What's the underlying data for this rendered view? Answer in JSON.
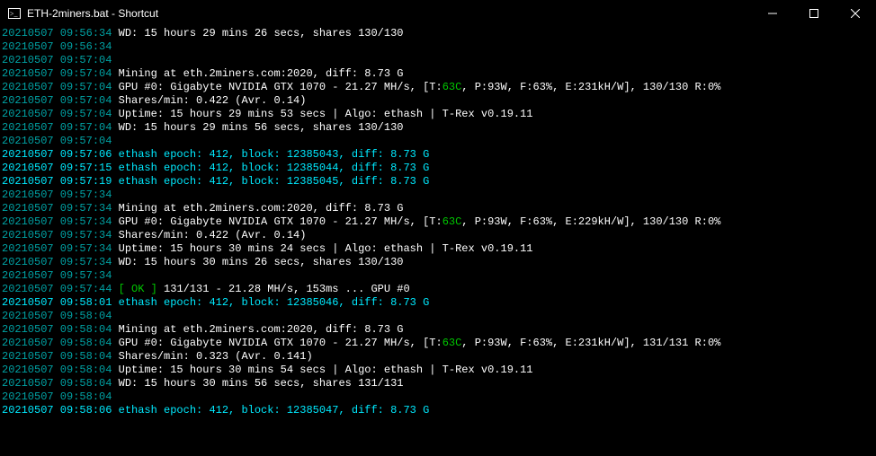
{
  "window": {
    "title": "ETH-2miners.bat - Shortcut"
  },
  "lines": [
    {
      "segs": [
        {
          "c": "ts",
          "t": "20210507 09:56:34"
        },
        {
          "c": "white",
          "t": " WD: 15 hours 29 mins 26 secs, shares 130/130"
        }
      ]
    },
    {
      "segs": [
        {
          "c": "ts",
          "t": "20210507 09:56:34"
        }
      ]
    },
    {
      "segs": [
        {
          "c": "ts",
          "t": "20210507 09:57:04"
        }
      ]
    },
    {
      "segs": [
        {
          "c": "ts",
          "t": "20210507 09:57:04"
        },
        {
          "c": "white",
          "t": " Mining at eth.2miners.com:2020, diff: 8.73 G"
        }
      ]
    },
    {
      "segs": [
        {
          "c": "ts",
          "t": "20210507 09:57:04"
        },
        {
          "c": "white",
          "t": " GPU #0: Gigabyte NVIDIA GTX 1070 - 21.27 MH/s, [T:"
        },
        {
          "c": "green",
          "t": "63C"
        },
        {
          "c": "white",
          "t": ", P:93W, F:63%, E:231kH/W], 130/130 R:0%"
        }
      ]
    },
    {
      "segs": [
        {
          "c": "ts",
          "t": "20210507 09:57:04"
        },
        {
          "c": "white",
          "t": " Shares/min: 0.422 (Avr. 0.14)"
        }
      ]
    },
    {
      "segs": [
        {
          "c": "ts",
          "t": "20210507 09:57:04"
        },
        {
          "c": "white",
          "t": " Uptime: 15 hours 29 mins 53 secs | Algo: ethash | T-Rex v0.19.11"
        }
      ]
    },
    {
      "segs": [
        {
          "c": "ts",
          "t": "20210507 09:57:04"
        },
        {
          "c": "white",
          "t": " WD: 15 hours 29 mins 56 secs, shares 130/130"
        }
      ]
    },
    {
      "segs": [
        {
          "c": "ts",
          "t": "20210507 09:57:04"
        }
      ]
    },
    {
      "segs": [
        {
          "c": "cyan",
          "t": "20210507 09:57:06 ethash epoch: 412, block: 12385043, diff: 8.73 G"
        }
      ]
    },
    {
      "segs": [
        {
          "c": "cyan",
          "t": "20210507 09:57:15 ethash epoch: 412, block: 12385044, diff: 8.73 G"
        }
      ]
    },
    {
      "segs": [
        {
          "c": "cyan",
          "t": "20210507 09:57:19 ethash epoch: 412, block: 12385045, diff: 8.73 G"
        }
      ]
    },
    {
      "segs": [
        {
          "c": "ts",
          "t": "20210507 09:57:34"
        }
      ]
    },
    {
      "segs": [
        {
          "c": "ts",
          "t": "20210507 09:57:34"
        },
        {
          "c": "white",
          "t": " Mining at eth.2miners.com:2020, diff: 8.73 G"
        }
      ]
    },
    {
      "segs": [
        {
          "c": "ts",
          "t": "20210507 09:57:34"
        },
        {
          "c": "white",
          "t": " GPU #0: Gigabyte NVIDIA GTX 1070 - 21.27 MH/s, [T:"
        },
        {
          "c": "green",
          "t": "63C"
        },
        {
          "c": "white",
          "t": ", P:93W, F:63%, E:229kH/W], 130/130 R:0%"
        }
      ]
    },
    {
      "segs": [
        {
          "c": "ts",
          "t": "20210507 09:57:34"
        },
        {
          "c": "white",
          "t": " Shares/min: 0.422 (Avr. 0.14)"
        }
      ]
    },
    {
      "segs": [
        {
          "c": "ts",
          "t": "20210507 09:57:34"
        },
        {
          "c": "white",
          "t": " Uptime: 15 hours 30 mins 24 secs | Algo: ethash | T-Rex v0.19.11"
        }
      ]
    },
    {
      "segs": [
        {
          "c": "ts",
          "t": "20210507 09:57:34"
        },
        {
          "c": "white",
          "t": " WD: 15 hours 30 mins 26 secs, shares 130/130"
        }
      ]
    },
    {
      "segs": [
        {
          "c": "ts",
          "t": "20210507 09:57:34"
        }
      ]
    },
    {
      "segs": [
        {
          "c": "ts",
          "t": "20210507 09:57:44"
        },
        {
          "c": "white",
          "t": " "
        },
        {
          "c": "green",
          "t": "[ OK ]"
        },
        {
          "c": "white",
          "t": " 131/131 - 21.28 MH/s, 153ms ... GPU #0"
        }
      ]
    },
    {
      "segs": [
        {
          "c": "cyan",
          "t": "20210507 09:58:01 ethash epoch: 412, block: 12385046, diff: 8.73 G"
        }
      ]
    },
    {
      "segs": [
        {
          "c": "ts",
          "t": "20210507 09:58:04"
        }
      ]
    },
    {
      "segs": [
        {
          "c": "ts",
          "t": "20210507 09:58:04"
        },
        {
          "c": "white",
          "t": " Mining at eth.2miners.com:2020, diff: 8.73 G"
        }
      ]
    },
    {
      "segs": [
        {
          "c": "ts",
          "t": "20210507 09:58:04"
        },
        {
          "c": "white",
          "t": " GPU #0: Gigabyte NVIDIA GTX 1070 - 21.27 MH/s, [T:"
        },
        {
          "c": "green",
          "t": "63C"
        },
        {
          "c": "white",
          "t": ", P:93W, F:63%, E:231kH/W], 131/131 R:0%"
        }
      ]
    },
    {
      "segs": [
        {
          "c": "ts",
          "t": "20210507 09:58:04"
        },
        {
          "c": "white",
          "t": " Shares/min: 0.323 (Avr. 0.141)"
        }
      ]
    },
    {
      "segs": [
        {
          "c": "ts",
          "t": "20210507 09:58:04"
        },
        {
          "c": "white",
          "t": " Uptime: 15 hours 30 mins 54 secs | Algo: ethash | T-Rex v0.19.11"
        }
      ]
    },
    {
      "segs": [
        {
          "c": "ts",
          "t": "20210507 09:58:04"
        },
        {
          "c": "white",
          "t": " WD: 15 hours 30 mins 56 secs, shares 131/131"
        }
      ]
    },
    {
      "segs": [
        {
          "c": "ts",
          "t": "20210507 09:58:04"
        }
      ]
    },
    {
      "segs": [
        {
          "c": "cyan",
          "t": "20210507 09:58:06 ethash epoch: 412, block: 12385047, diff: 8.73 G"
        }
      ]
    }
  ]
}
